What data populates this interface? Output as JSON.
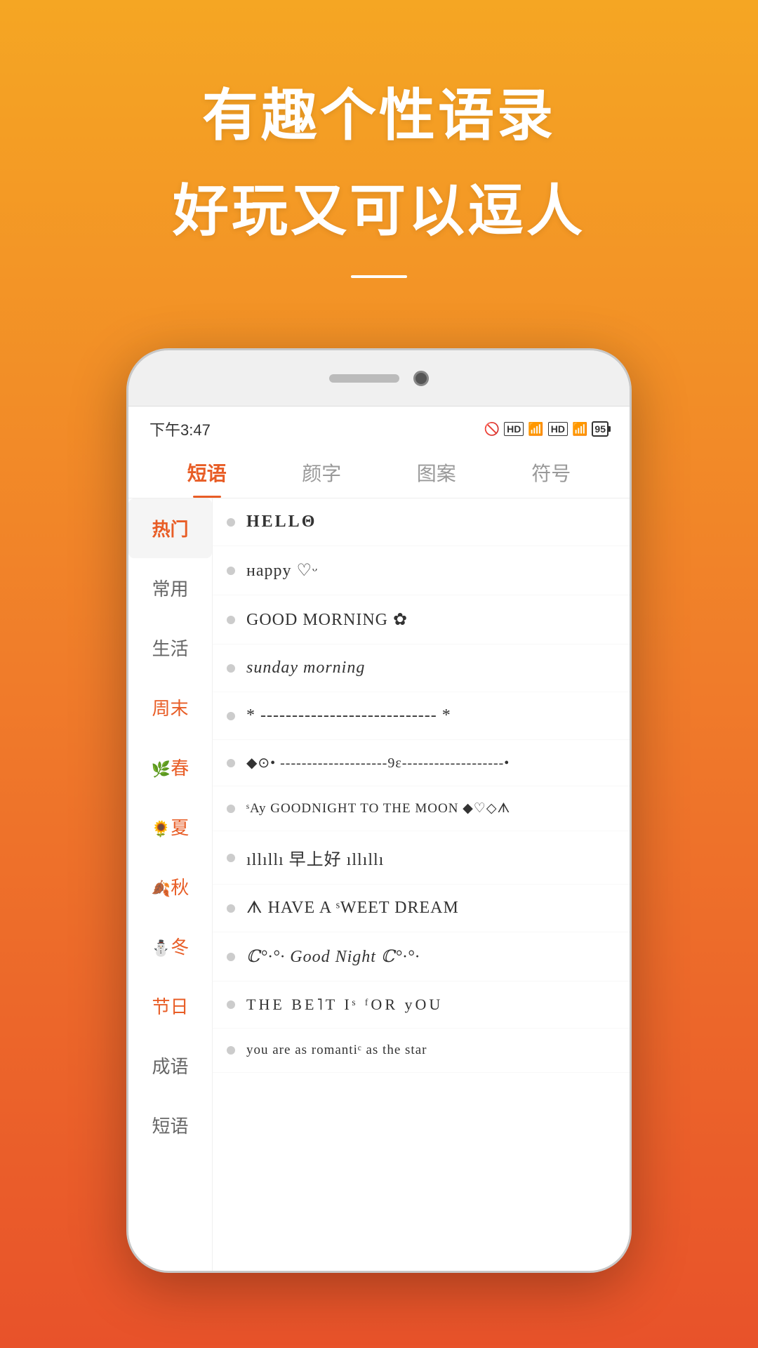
{
  "hero": {
    "title1": "有趣个性语录",
    "title2": "好玩又可以逗人"
  },
  "status_bar": {
    "time": "下午3:47",
    "battery": "95"
  },
  "tabs": [
    {
      "label": "短语",
      "active": true
    },
    {
      "label": "颜字",
      "active": false
    },
    {
      "label": "图案",
      "active": false
    },
    {
      "label": "符号",
      "active": false
    }
  ],
  "sidebar": [
    {
      "label": "热门",
      "active": true,
      "emoji": ""
    },
    {
      "label": "常用",
      "active": false,
      "emoji": ""
    },
    {
      "label": "生活",
      "active": false,
      "emoji": ""
    },
    {
      "label": "周末",
      "active": false,
      "emoji": ""
    },
    {
      "label": "春",
      "active": false,
      "emoji": "🌿"
    },
    {
      "label": "夏",
      "active": false,
      "emoji": "🌻"
    },
    {
      "label": "秋",
      "active": false,
      "emoji": "🍂"
    },
    {
      "label": "冬",
      "active": false,
      "emoji": "⛄"
    },
    {
      "label": "节日",
      "active": false,
      "emoji": ""
    },
    {
      "label": "成语",
      "active": false,
      "emoji": ""
    },
    {
      "label": "短语",
      "active": false,
      "emoji": ""
    }
  ],
  "list_items": [
    {
      "text": "HELLΘ",
      "style": "fancy"
    },
    {
      "text": "нappy ♡ᵕ",
      "style": "normal"
    },
    {
      "text": "GOOD MORNING ✿",
      "style": "normal"
    },
    {
      "text": "sunday morning",
      "style": "italic"
    },
    {
      "text": "* ----------------------------  *",
      "style": "normal"
    },
    {
      "text": "◆⊙• --------------------9ε-------------------•",
      "style": "normal"
    },
    {
      "text": "ˢAy GOODNIGHT TO THE MOON ◆♡◇ᗑ",
      "style": "small"
    },
    {
      "text": "ıllıllı 早上好 ıllıllı",
      "style": "normal"
    },
    {
      "text": "ᗑ HAVE A ˢWEET DREAM",
      "style": "normal"
    },
    {
      "text": "ℂ°·°· Good Night ℂ°·°·",
      "style": "mixed"
    },
    {
      "text": "THE BE˥T Iˢ ᶠOR yOU",
      "style": "normal"
    },
    {
      "text": "you are as romantiᶜ as the star",
      "style": "small"
    }
  ]
}
